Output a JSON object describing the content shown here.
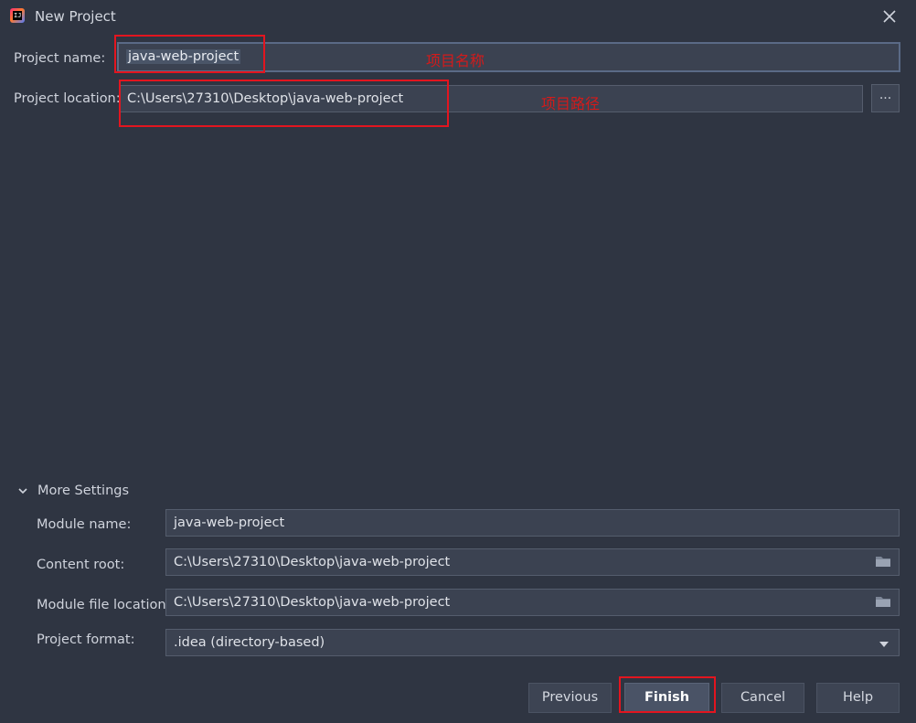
{
  "window": {
    "title": "New Project",
    "app_icon": "intellij-idea-icon"
  },
  "project": {
    "name_label": "Project name:",
    "name_value": "java-web-project",
    "location_label": "Project location:",
    "location_value": "C:\\Users\\27310\\Desktop\\java-web-project",
    "browse_label": "..."
  },
  "annotations": {
    "name_note": "项目名称",
    "location_note": "项目路径",
    "color": "#e3151f"
  },
  "more_settings": {
    "header": "More Settings",
    "expanded": true,
    "module_name_label": "Module name:",
    "module_name_value": "java-web-project",
    "content_root_label": "Content root:",
    "content_root_value": "C:\\Users\\27310\\Desktop\\java-web-project",
    "module_file_label": "Module file location:",
    "module_file_value": "C:\\Users\\27310\\Desktop\\java-web-project",
    "format_label": "Project format:",
    "format_value": ".idea (directory-based)"
  },
  "buttons": {
    "previous": "Previous",
    "finish": "Finish",
    "cancel": "Cancel",
    "help": "Help"
  },
  "colors": {
    "background": "#2f3542",
    "field_bg": "#3b4251",
    "accent_red": "#e3151f"
  }
}
